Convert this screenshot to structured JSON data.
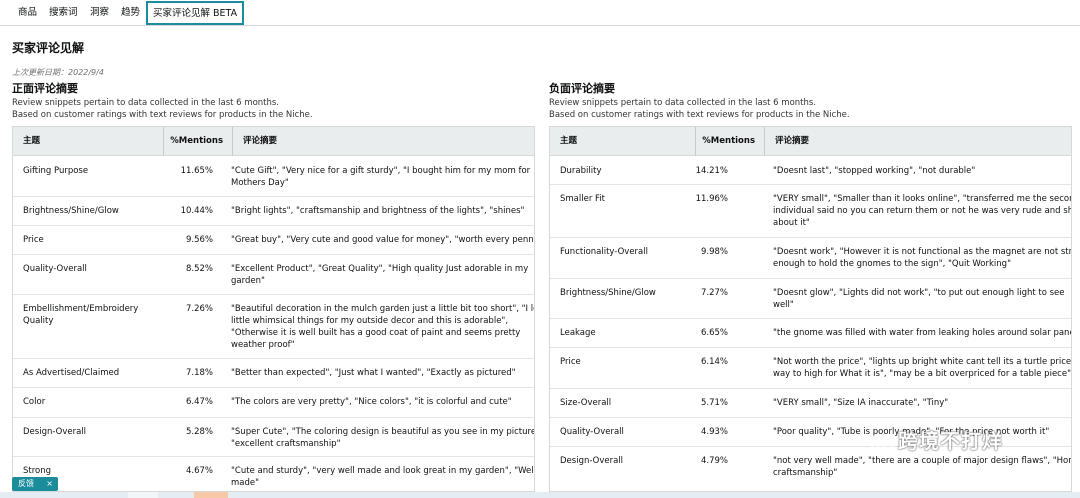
{
  "tabs": [
    "商品",
    "搜索词",
    "洞察",
    "趋势",
    "买家评论见解 BETA"
  ],
  "page_title": "买家评论见解",
  "last_updated": "上次更新日期：2022/9/4",
  "positive": {
    "title": "正面评论摘要",
    "desc1": "Review snippets pertain to data collected in the last 6 months.",
    "desc2": "Based on customer ratings with text reviews for products in the Niche.",
    "headers": {
      "topic": "主题",
      "mentions": "%Mentions",
      "summary": "评论摘要"
    },
    "rows": [
      {
        "topic": "Gifting Purpose",
        "pct": "11.65%",
        "summary_lines": [
          "\"Cute Gift\", \"Very nice for a gift sturdy\", \"I bought him for my mom for",
          "Mothers Day\""
        ]
      },
      {
        "topic": "Brightness/Shine/Glow",
        "pct": "10.44%",
        "summary_lines": [
          "\"Bright lights\", \"craftsmanship and brightness of the lights\", \"shines\""
        ]
      },
      {
        "topic": "Price",
        "pct": "9.56%",
        "summary_lines": [
          "\"Great buy\", \"Very cute and good value for money\", \"worth every penny\""
        ]
      },
      {
        "topic": "Quality-Overall",
        "pct": "8.52%",
        "summary_lines": [
          "\"Excellent Product\", \"Great Quality\", \"High quality Just adorable in my",
          "garden\""
        ]
      },
      {
        "topic_lines": [
          "Embellishment/Embroidery",
          "Quality"
        ],
        "pct": "7.26%",
        "summary_lines": [
          "\"Beautiful decoration in the mulch garden just a little bit too short\", \"I love",
          "little whimsical things for my outside decor and this is adorable\",",
          "\"Otherwise it is well built has a good coat of paint and seems pretty",
          "weather proof\""
        ]
      },
      {
        "topic": "As Advertised/Claimed",
        "pct": "7.18%",
        "summary_lines": [
          "\"Better than expected\", \"Just what I wanted\", \"Exactly as pictured\""
        ]
      },
      {
        "topic": "Color",
        "pct": "6.47%",
        "summary_lines": [
          "\"The colors are very pretty\", \"Nice colors\", \"it is colorful and cute\""
        ]
      },
      {
        "topic": "Design-Overall",
        "pct": "5.28%",
        "summary_lines": [
          "\"Super Cute\", \"The coloring design is beautiful as you see in my pictures\",",
          "\"excellent craftsmanship\""
        ]
      },
      {
        "topic": "Strong",
        "pct": "4.67%",
        "summary_lines": [
          "\"Cute and sturdy\", \"very well made and look great in my garden\", \"Well",
          "made\""
        ]
      }
    ]
  },
  "negative": {
    "title": "负面评论摘要",
    "desc1": "Review snippets pertain to data collected in the last 6 months.",
    "desc2": "Based on customer ratings with text reviews for products in the Niche.",
    "headers": {
      "topic": "主题",
      "mentions": "%Mentions",
      "summary": "评论摘要"
    },
    "rows": [
      {
        "topic": "Durability",
        "pct": "14.21%",
        "summary_lines": [
          "\"Doesnt last\", \"stopped working\", \"not durable\""
        ]
      },
      {
        "topic": "Smaller Fit",
        "pct": "11.96%",
        "summary_lines": [
          "\"VERY small\", \"Smaller than it looks online\", \"transferred me the second",
          "individual said no you can return them or not he was very rude and short",
          "about it\""
        ]
      },
      {
        "topic": "Functionality-Overall",
        "pct": "9.98%",
        "summary_lines": [
          "\"Doesnt work\", \"However it is not functional as the magnet are not strong",
          "enough to hold the gnomes to the sign\", \"Quit Working\""
        ]
      },
      {
        "topic": "Brightness/Shine/Glow",
        "pct": "7.27%",
        "summary_lines": [
          "\"Doesnt glow\", \"Lights did not work\", \"to put out enough light to see",
          "well\""
        ]
      },
      {
        "topic": "Leakage",
        "pct": "6.65%",
        "summary_lines": [
          "\"the gnome was filled with water from leaking holes around solar panel\""
        ]
      },
      {
        "topic": "Price",
        "pct": "6.14%",
        "summary_lines": [
          "\"Not worth the price\", \"lights up bright white cant tell its a turtle priced",
          "way to high for What it is\", \"may be a bit overpriced for a table piece\""
        ]
      },
      {
        "topic": "Size-Overall",
        "pct": "5.71%",
        "summary_lines": [
          "\"VERY small\", \"Size IA inaccurate\", \"Tiny\""
        ]
      },
      {
        "topic": "Quality-Overall",
        "pct": "4.93%",
        "summary_lines": [
          "\"Poor quality\", \"Tube is poorly made\", \"For the price not worth it\""
        ]
      },
      {
        "topic": "Design-Overall",
        "pct": "4.79%",
        "summary_lines": [
          "\"not very well made\", \"there are a couple of major design flaws\", \"Horrible",
          "craftsmanship\""
        ]
      }
    ]
  },
  "feedback": {
    "label": "反馈",
    "close": "×"
  },
  "watermark": "跨境不打烊",
  "colors": {
    "accent": "#1d8c9c",
    "header_bg": "#eaeded",
    "border": "#d5d9d9"
  }
}
